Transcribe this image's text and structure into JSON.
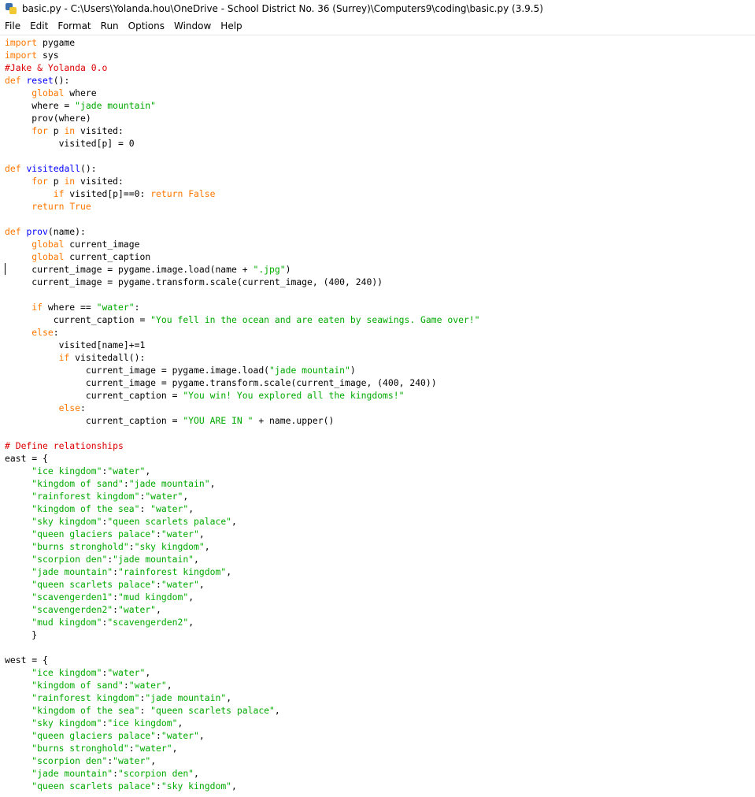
{
  "window": {
    "title": "basic.py - C:\\Users\\Yolanda.hou\\OneDrive - School District No. 36 (Surrey)\\Computers9\\coding\\basic.py (3.9.5)",
    "icon": "python-idle-icon"
  },
  "menu": [
    "File",
    "Edit",
    "Format",
    "Run",
    "Options",
    "Window",
    "Help"
  ],
  "colors": {
    "keyword": "#ff7700",
    "string": "#00aa00",
    "comment": "#dd0000",
    "definition": "#0000ff",
    "text": "#000000",
    "background": "#ffffff"
  },
  "editor": {
    "lines": [
      [
        [
          "kw",
          "import"
        ],
        [
          "t",
          " pygame"
        ]
      ],
      [
        [
          "kw",
          "import"
        ],
        [
          "t",
          " sys"
        ]
      ],
      [
        [
          "cmt",
          "#Jake & Yolanda 0.o"
        ]
      ],
      [
        [
          "kw",
          "def"
        ],
        [
          "t",
          " "
        ],
        [
          "def",
          "reset"
        ],
        [
          "t",
          "():"
        ]
      ],
      [
        [
          "t",
          "     "
        ],
        [
          "kw",
          "global"
        ],
        [
          "t",
          " where"
        ]
      ],
      [
        [
          "t",
          "     where = "
        ],
        [
          "str",
          "\"jade mountain\""
        ]
      ],
      [
        [
          "t",
          "     prov(where)"
        ]
      ],
      [
        [
          "t",
          "     "
        ],
        [
          "kw",
          "for"
        ],
        [
          "t",
          " p "
        ],
        [
          "kw",
          "in"
        ],
        [
          "t",
          " visited:"
        ]
      ],
      [
        [
          "t",
          "          visited[p] = 0"
        ]
      ],
      [],
      [
        [
          "kw",
          "def"
        ],
        [
          "t",
          " "
        ],
        [
          "def",
          "visitedall"
        ],
        [
          "t",
          "():"
        ]
      ],
      [
        [
          "t",
          "     "
        ],
        [
          "kw",
          "for"
        ],
        [
          "t",
          " p "
        ],
        [
          "kw",
          "in"
        ],
        [
          "t",
          " visited:"
        ]
      ],
      [
        [
          "t",
          "         "
        ],
        [
          "kw",
          "if"
        ],
        [
          "t",
          " visited[p]==0: "
        ],
        [
          "kw",
          "return"
        ],
        [
          "t",
          " "
        ],
        [
          "kw",
          "False"
        ]
      ],
      [
        [
          "t",
          "     "
        ],
        [
          "kw",
          "return"
        ],
        [
          "t",
          " "
        ],
        [
          "kw",
          "True"
        ]
      ],
      [],
      [
        [
          "kw",
          "def"
        ],
        [
          "t",
          " "
        ],
        [
          "def",
          "prov"
        ],
        [
          "t",
          "(name):"
        ]
      ],
      [
        [
          "t",
          "     "
        ],
        [
          "kw",
          "global"
        ],
        [
          "t",
          " current_image"
        ]
      ],
      [
        [
          "t",
          "     "
        ],
        [
          "kw",
          "global"
        ],
        [
          "t",
          " current_caption"
        ]
      ],
      [
        [
          "t",
          "     current_image = pygame.image.load(name + "
        ],
        [
          "str",
          "\".jpg\""
        ],
        [
          "t",
          ")"
        ]
      ],
      [
        [
          "t",
          "     current_image = pygame.transform.scale(current_image, (400, 240))"
        ]
      ],
      [],
      [
        [
          "t",
          "     "
        ],
        [
          "kw",
          "if"
        ],
        [
          "t",
          " where == "
        ],
        [
          "str",
          "\"water\""
        ],
        [
          "t",
          ":"
        ]
      ],
      [
        [
          "t",
          "         current_caption = "
        ],
        [
          "str",
          "\"You fell in the ocean and are eaten by seawings. Game over!\""
        ]
      ],
      [
        [
          "t",
          "     "
        ],
        [
          "kw",
          "else"
        ],
        [
          "t",
          ":"
        ]
      ],
      [
        [
          "t",
          "          visited[name]+=1"
        ]
      ],
      [
        [
          "t",
          "          "
        ],
        [
          "kw",
          "if"
        ],
        [
          "t",
          " visitedall():"
        ]
      ],
      [
        [
          "t",
          "               current_image = pygame.image.load("
        ],
        [
          "str",
          "\"jade mountain\""
        ],
        [
          "t",
          ")"
        ]
      ],
      [
        [
          "t",
          "               current_image = pygame.transform.scale(current_image, (400, 240))"
        ]
      ],
      [
        [
          "t",
          "               current_caption = "
        ],
        [
          "str",
          "\"You win! You explored all the kingdoms!\""
        ]
      ],
      [
        [
          "t",
          "          "
        ],
        [
          "kw",
          "else"
        ],
        [
          "t",
          ":"
        ]
      ],
      [
        [
          "t",
          "               current_caption = "
        ],
        [
          "str",
          "\"YOU ARE IN \""
        ],
        [
          "t",
          " + name.upper()"
        ]
      ],
      [],
      [
        [
          "cmt",
          "# Define relationships"
        ]
      ],
      [
        [
          "t",
          "east = {"
        ]
      ],
      [
        [
          "t",
          "     "
        ],
        [
          "str",
          "\"ice kingdom\""
        ],
        [
          "t",
          ":"
        ],
        [
          "str",
          "\"water\""
        ],
        [
          "t",
          ","
        ]
      ],
      [
        [
          "t",
          "     "
        ],
        [
          "str",
          "\"kingdom of sand\""
        ],
        [
          "t",
          ":"
        ],
        [
          "str",
          "\"jade mountain\""
        ],
        [
          "t",
          ","
        ]
      ],
      [
        [
          "t",
          "     "
        ],
        [
          "str",
          "\"rainforest kingdom\""
        ],
        [
          "t",
          ":"
        ],
        [
          "str",
          "\"water\""
        ],
        [
          "t",
          ","
        ]
      ],
      [
        [
          "t",
          "     "
        ],
        [
          "str",
          "\"kingdom of the sea\""
        ],
        [
          "t",
          ": "
        ],
        [
          "str",
          "\"water\""
        ],
        [
          "t",
          ","
        ]
      ],
      [
        [
          "t",
          "     "
        ],
        [
          "str",
          "\"sky kingdom\""
        ],
        [
          "t",
          ":"
        ],
        [
          "str",
          "\"queen scarlets palace\""
        ],
        [
          "t",
          ","
        ]
      ],
      [
        [
          "t",
          "     "
        ],
        [
          "str",
          "\"queen glaciers palace\""
        ],
        [
          "t",
          ":"
        ],
        [
          "str",
          "\"water\""
        ],
        [
          "t",
          ","
        ]
      ],
      [
        [
          "t",
          "     "
        ],
        [
          "str",
          "\"burns stronghold\""
        ],
        [
          "t",
          ":"
        ],
        [
          "str",
          "\"sky kingdom\""
        ],
        [
          "t",
          ","
        ]
      ],
      [
        [
          "t",
          "     "
        ],
        [
          "str",
          "\"scorpion den\""
        ],
        [
          "t",
          ":"
        ],
        [
          "str",
          "\"jade mountain\""
        ],
        [
          "t",
          ","
        ]
      ],
      [
        [
          "t",
          "     "
        ],
        [
          "str",
          "\"jade mountain\""
        ],
        [
          "t",
          ":"
        ],
        [
          "str",
          "\"rainforest kingdom\""
        ],
        [
          "t",
          ","
        ]
      ],
      [
        [
          "t",
          "     "
        ],
        [
          "str",
          "\"queen scarlets palace\""
        ],
        [
          "t",
          ":"
        ],
        [
          "str",
          "\"water\""
        ],
        [
          "t",
          ","
        ]
      ],
      [
        [
          "t",
          "     "
        ],
        [
          "str",
          "\"scavengerden1\""
        ],
        [
          "t",
          ":"
        ],
        [
          "str",
          "\"mud kingdom\""
        ],
        [
          "t",
          ","
        ]
      ],
      [
        [
          "t",
          "     "
        ],
        [
          "str",
          "\"scavengerden2\""
        ],
        [
          "t",
          ":"
        ],
        [
          "str",
          "\"water\""
        ],
        [
          "t",
          ","
        ]
      ],
      [
        [
          "t",
          "     "
        ],
        [
          "str",
          "\"mud kingdom\""
        ],
        [
          "t",
          ":"
        ],
        [
          "str",
          "\"scavengerden2\""
        ],
        [
          "t",
          ","
        ]
      ],
      [
        [
          "t",
          "     }"
        ]
      ],
      [],
      [
        [
          "t",
          "west = {"
        ]
      ],
      [
        [
          "t",
          "     "
        ],
        [
          "str",
          "\"ice kingdom\""
        ],
        [
          "t",
          ":"
        ],
        [
          "str",
          "\"water\""
        ],
        [
          "t",
          ","
        ]
      ],
      [
        [
          "t",
          "     "
        ],
        [
          "str",
          "\"kingdom of sand\""
        ],
        [
          "t",
          ":"
        ],
        [
          "str",
          "\"water\""
        ],
        [
          "t",
          ","
        ]
      ],
      [
        [
          "t",
          "     "
        ],
        [
          "str",
          "\"rainforest kingdom\""
        ],
        [
          "t",
          ":"
        ],
        [
          "str",
          "\"jade mountain\""
        ],
        [
          "t",
          ","
        ]
      ],
      [
        [
          "t",
          "     "
        ],
        [
          "str",
          "\"kingdom of the sea\""
        ],
        [
          "t",
          ": "
        ],
        [
          "str",
          "\"queen scarlets palace\""
        ],
        [
          "t",
          ","
        ]
      ],
      [
        [
          "t",
          "     "
        ],
        [
          "str",
          "\"sky kingdom\""
        ],
        [
          "t",
          ":"
        ],
        [
          "str",
          "\"ice kingdom\""
        ],
        [
          "t",
          ","
        ]
      ],
      [
        [
          "t",
          "     "
        ],
        [
          "str",
          "\"queen glaciers palace\""
        ],
        [
          "t",
          ":"
        ],
        [
          "str",
          "\"water\""
        ],
        [
          "t",
          ","
        ]
      ],
      [
        [
          "t",
          "     "
        ],
        [
          "str",
          "\"burns stronghold\""
        ],
        [
          "t",
          ":"
        ],
        [
          "str",
          "\"water\""
        ],
        [
          "t",
          ","
        ]
      ],
      [
        [
          "t",
          "     "
        ],
        [
          "str",
          "\"scorpion den\""
        ],
        [
          "t",
          ":"
        ],
        [
          "str",
          "\"water\""
        ],
        [
          "t",
          ","
        ]
      ],
      [
        [
          "t",
          "     "
        ],
        [
          "str",
          "\"jade mountain\""
        ],
        [
          "t",
          ":"
        ],
        [
          "str",
          "\"scorpion den\""
        ],
        [
          "t",
          ","
        ]
      ],
      [
        [
          "t",
          "     "
        ],
        [
          "str",
          "\"queen scarlets palace\""
        ],
        [
          "t",
          ":"
        ],
        [
          "str",
          "\"sky kingdom\""
        ],
        [
          "t",
          ","
        ]
      ]
    ]
  }
}
